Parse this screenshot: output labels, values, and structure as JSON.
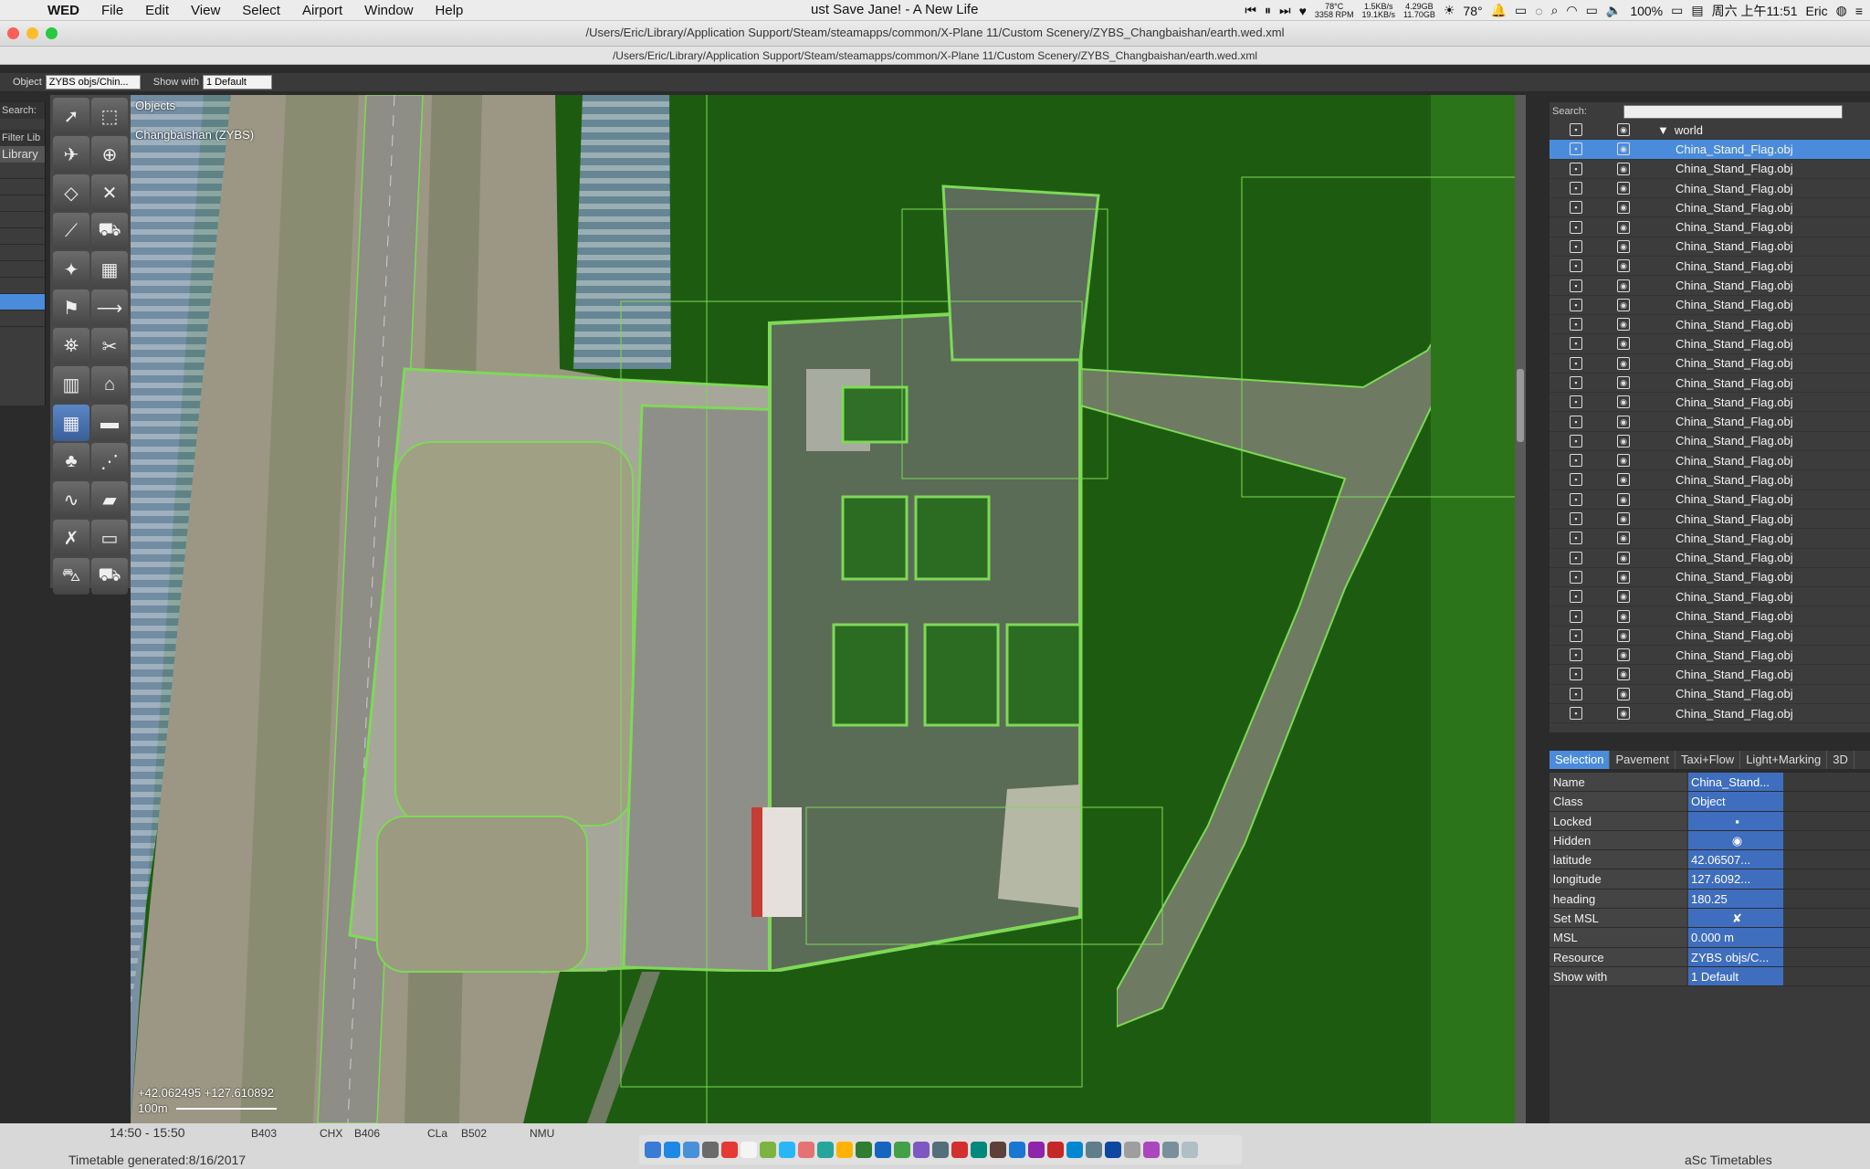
{
  "menubar": {
    "app_name": "WED",
    "menus": [
      "File",
      "Edit",
      "View",
      "Select",
      "Airport",
      "Window",
      "Help"
    ],
    "now_playing": "ust Save Jane! - A New Life",
    "cpu_temp": "78°C",
    "fan_rpm": "3358 RPM",
    "net_up": "1.5KB/s",
    "net_down": "19.1KB/s",
    "mem_used": "4.29GB",
    "mem_free": "11.70GB",
    "weather": "78°",
    "battery": "100%",
    "clock": "周六 上午11:51",
    "user": "Eric"
  },
  "window": {
    "title": "/Users/Eric/Library/Application Support/Steam/steamapps/common/X-Plane 11/Custom Scenery/ZYBS_Changbaishan/earth.wed.xml",
    "path": "/Users/Eric/Library/Application Support/Steam/steamapps/common/X-Plane 11/Custom Scenery/ZYBS_Changbaishan/earth.wed.xml"
  },
  "toolbar": {
    "object_label": "Object",
    "object_value": "ZYBS objs/Chin...",
    "show_with_label": "Show with",
    "show_with_value": "1 Default"
  },
  "library": {
    "search_label": "Search:",
    "filter_label": "Filter Lib",
    "header": "Library"
  },
  "map": {
    "header_objects": "Objects",
    "header_airport": "Changbaishan (ZYBS)",
    "coords": "+42.062495 +127.610892",
    "scale": "100m"
  },
  "tree": {
    "search_label": "Search:",
    "root": "world",
    "items": [
      "China_Stand_Flag.obj",
      "China_Stand_Flag.obj",
      "China_Stand_Flag.obj",
      "China_Stand_Flag.obj",
      "China_Stand_Flag.obj",
      "China_Stand_Flag.obj",
      "China_Stand_Flag.obj",
      "China_Stand_Flag.obj",
      "China_Stand_Flag.obj",
      "China_Stand_Flag.obj",
      "China_Stand_Flag.obj",
      "China_Stand_Flag.obj",
      "China_Stand_Flag.obj",
      "China_Stand_Flag.obj",
      "China_Stand_Flag.obj",
      "China_Stand_Flag.obj",
      "China_Stand_Flag.obj",
      "China_Stand_Flag.obj",
      "China_Stand_Flag.obj",
      "China_Stand_Flag.obj",
      "China_Stand_Flag.obj",
      "China_Stand_Flag.obj",
      "China_Stand_Flag.obj",
      "China_Stand_Flag.obj",
      "China_Stand_Flag.obj",
      "China_Stand_Flag.obj",
      "China_Stand_Flag.obj",
      "China_Stand_Flag.obj",
      "China_Stand_Flag.obj",
      "China_Stand_Flag.obj"
    ]
  },
  "tabs": [
    "Selection",
    "Pavement",
    "Taxi+Flow",
    "Light+Marking",
    "3D"
  ],
  "properties": [
    {
      "key": "Name",
      "value": "China_Stand..."
    },
    {
      "key": "Class",
      "value": "Object"
    },
    {
      "key": "Locked",
      "value": "▪"
    },
    {
      "key": "Hidden",
      "value": "◉"
    },
    {
      "key": "latitude",
      "value": "42.06507..."
    },
    {
      "key": "longitude",
      "value": "127.6092..."
    },
    {
      "key": "heading",
      "value": "180.25"
    },
    {
      "key": "Set MSL",
      "value": "✘"
    },
    {
      "key": "MSL",
      "value": "0.000 m"
    },
    {
      "key": "Resource",
      "value": "ZYBS objs/C..."
    },
    {
      "key": "Show with",
      "value": "1 Default"
    }
  ],
  "background_window": {
    "time": "14:50 - 15:50",
    "codes": [
      "B403",
      "CHX",
      "B406",
      "CLa",
      "B502",
      "NMU"
    ],
    "footer_left": "Timetable generated:8/16/2017",
    "footer_right": "aSc Timetables"
  },
  "colors": {
    "grass": "#1d5c10",
    "selection": "#4a8cdb",
    "taxi_line": "#7ed957"
  }
}
